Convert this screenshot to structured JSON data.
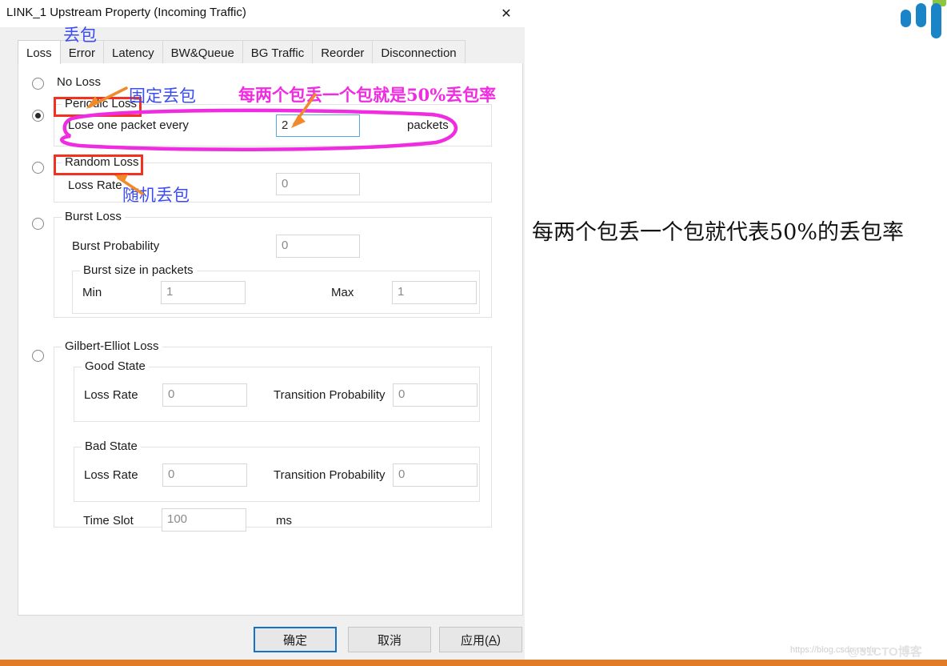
{
  "window": {
    "title": "LINK_1 Upstream Property (Incoming Traffic)",
    "close_icon": "✕"
  },
  "tabs": [
    {
      "label": "Loss",
      "active": true
    },
    {
      "label": "Error",
      "active": false
    },
    {
      "label": "Latency",
      "active": false
    },
    {
      "label": "BW&Queue",
      "active": false
    },
    {
      "label": "BG Traffic",
      "active": false
    },
    {
      "label": "Reorder",
      "active": false
    },
    {
      "label": "Disconnection",
      "active": false
    }
  ],
  "loss_tab": {
    "no_loss": {
      "label": "No Loss",
      "selected": false
    },
    "periodic_loss": {
      "title": "Periodic Loss",
      "selected": true,
      "field_label": "Lose one packet every",
      "value": "2",
      "unit": "packets"
    },
    "random_loss": {
      "title": "Random Loss",
      "selected": false,
      "field_label": "Loss Rate",
      "value": "0"
    },
    "burst_loss": {
      "title": "Burst Loss",
      "selected": false,
      "probability_label": "Burst Probability",
      "probability_value": "0",
      "size_group_title": "Burst size in packets",
      "min_label": "Min",
      "min_value": "1",
      "max_label": "Max",
      "max_value": "1"
    },
    "gilbert_elliot_loss": {
      "title": "Gilbert-Elliot Loss",
      "selected": false,
      "good_state": {
        "title": "Good State",
        "loss_rate_label": "Loss Rate",
        "loss_rate_value": "0",
        "transition_label": "Transition Probability",
        "transition_value": "0"
      },
      "bad_state": {
        "title": "Bad State",
        "loss_rate_label": "Loss Rate",
        "loss_rate_value": "0",
        "transition_label": "Transition Probability",
        "transition_value": "0"
      },
      "time_slot_label": "Time Slot",
      "time_slot_value": "100",
      "time_slot_unit": "ms"
    }
  },
  "footer": {
    "ok": "确定",
    "cancel": "取消",
    "apply_prefix": "应用(",
    "apply_key": "A",
    "apply_suffix": ")"
  },
  "annotations": {
    "blue_loss": "丢包",
    "blue_fixed_loss": "固定丢包",
    "blue_random_loss": "随机丢包",
    "magenta_note": "每两个包丢一个包就是50%丢包率",
    "right_note": "每两个包丢一个包就代表50%的丢包率"
  },
  "watermark": {
    "url": "https://blog.csdn.net/n",
    "brand": "@51CTO博客"
  },
  "colors": {
    "red_box": "#f4301e",
    "magenta": "#f02ce0",
    "blue_anno": "#3b4cf0",
    "orange_arrow": "#f08a2a",
    "focus_blue": "#5aa6e0",
    "default_btn_blue": "#1572c4",
    "logo_blue": "#1a84c7",
    "logo_green": "#8cc63f",
    "bottom_bar": "#e07b28"
  }
}
